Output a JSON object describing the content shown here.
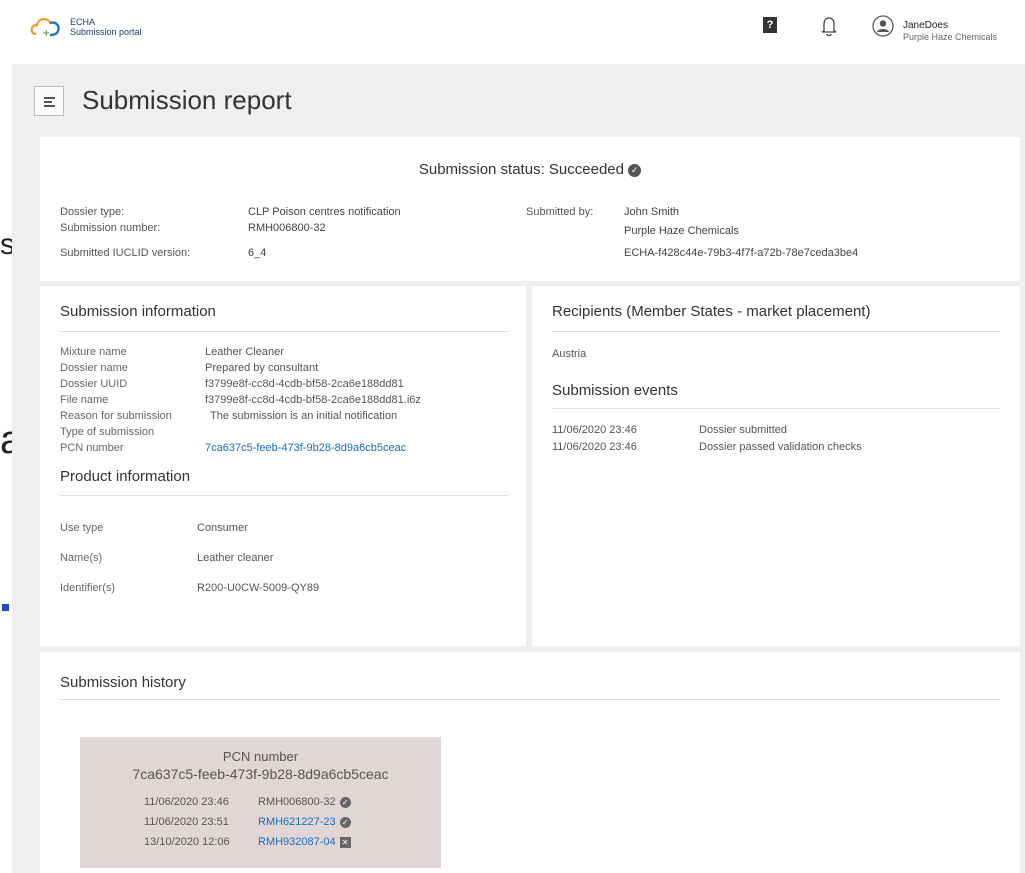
{
  "fragments": {
    "s": "s",
    "a": "a"
  },
  "header": {
    "logo_line1": "ECHA",
    "logo_line2": "Submission portal",
    "help_icon": "?",
    "user_name": "JaneDoes",
    "user_org": "Purple Haze Chemicals"
  },
  "page": {
    "title": "Submission report"
  },
  "status": {
    "label": "Submission status:",
    "value": "Succeeded",
    "dossier_type_label": "Dossier type:",
    "dossier_type": "CLP Poison centres notification",
    "submission_number_label": "Submission number:",
    "submission_number": "RMH006800-32",
    "iuclid_label": "Submitted IUCLID version:",
    "iuclid_version": "6_4",
    "submitted_by_label": "Submitted by:",
    "submitted_by_name": "John Smith",
    "submitted_by_org": "Purple Haze Chemicals",
    "submitted_by_id": "ECHA-f428c44e-79b3-4f7f-a72b-78e7ceda3be4"
  },
  "submission_info": {
    "title": "Submission information",
    "rows": [
      {
        "label": "Mixture name",
        "value": "Leather Cleaner"
      },
      {
        "label": "Dossier name",
        "value": "Prepared by consultant"
      },
      {
        "label": "Dossier UUID",
        "value": "f3799e8f-cc8d-4cdb-bf58-2ca6e188dd81"
      },
      {
        "label": "File name",
        "value": "f3799e8f-cc8d-4cdb-bf58-2ca6e188dd81.i6z"
      },
      {
        "label": "Reason for submission",
        "value": "The submission is an initial notification"
      },
      {
        "label": "Type of submission",
        "value": ""
      },
      {
        "label": "PCN number",
        "value": "7ca637c5-feeb-473f-9b28-8d9a6cb5ceac"
      }
    ]
  },
  "product_info": {
    "title": "Product information",
    "rows": [
      {
        "label": "Use type",
        "value": "Consumer"
      },
      {
        "label": "Name(s)",
        "value": "Leather cleaner"
      },
      {
        "label": "Identifier(s)",
        "value": "R200-U0CW-5009-QY89"
      }
    ]
  },
  "recipients": {
    "title": "Recipients (Member States - market placement)",
    "items": [
      "Austria"
    ]
  },
  "events": {
    "title": "Submission events",
    "rows": [
      {
        "date": "11/06/2020 23:46",
        "text": "Dossier submitted"
      },
      {
        "date": "11/06/2020 23:46",
        "text": "Dossier passed validation checks"
      }
    ]
  },
  "history": {
    "title": "Submission history",
    "box_title": "PCN number",
    "box_pcn": "7ca637c5-feeb-473f-9b28-8d9a6cb5ceac",
    "rows": [
      {
        "date": "11/06/2020 23:46",
        "number": "RMH006800-32",
        "is_link": false,
        "status_icon": "check-circle-icon"
      },
      {
        "date": "11/06/2020 23:51",
        "number": "RMH621227-23",
        "is_link": true,
        "status_icon": "check-circle-icon"
      },
      {
        "date": "13/10/2020 12:06",
        "number": "RMH932087-04",
        "is_link": true,
        "status_icon": "cross-square-icon"
      }
    ]
  }
}
